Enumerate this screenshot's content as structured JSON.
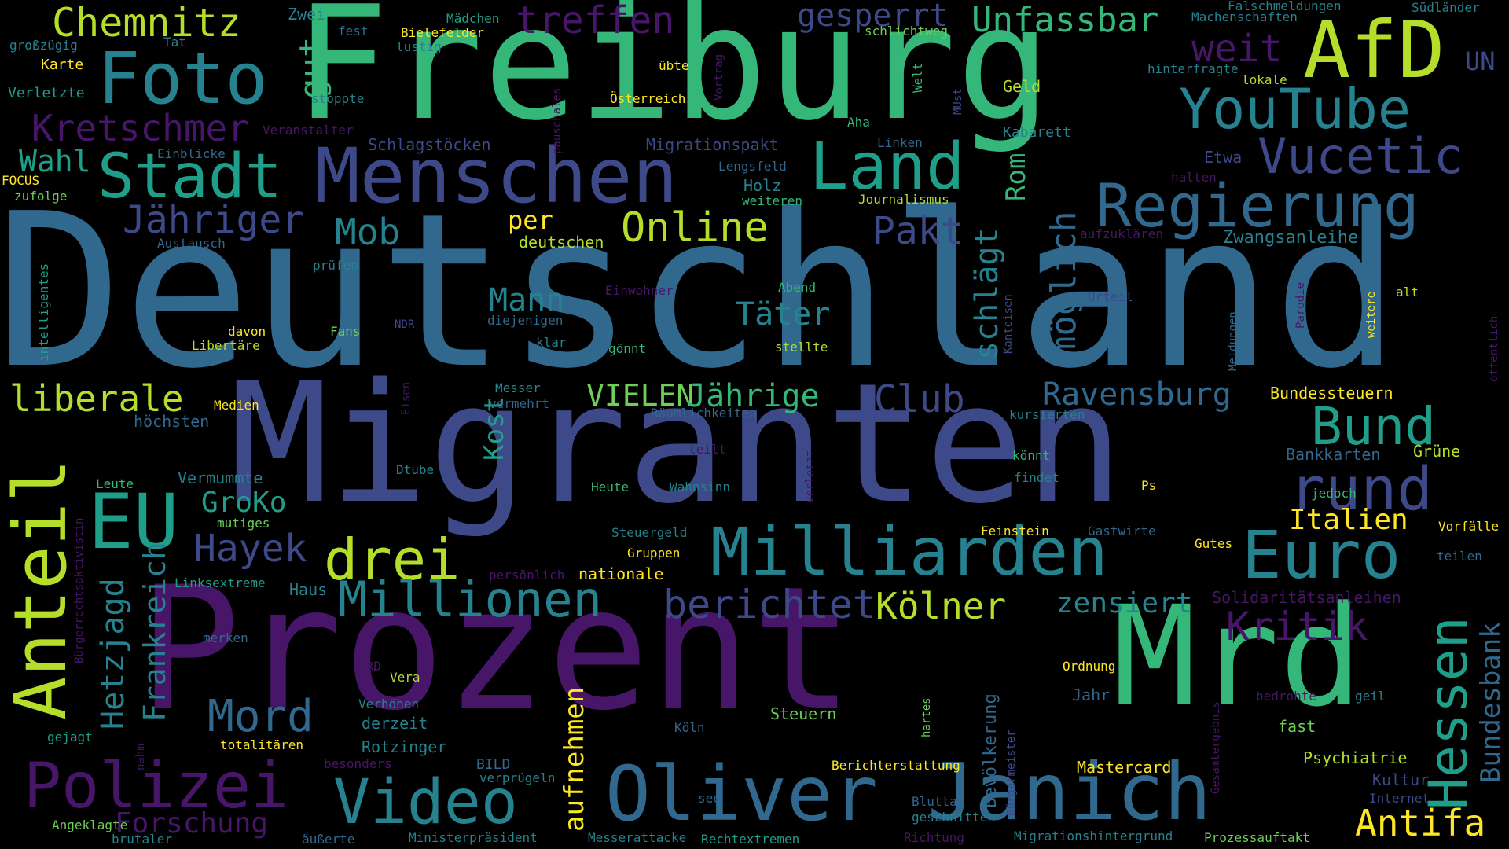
{
  "colors": {
    "background": "#000000",
    "dark_purple": "#481668",
    "indigo": "#3e4989",
    "steel_blue": "#31688e",
    "teal_blue": "#26828e",
    "teal": "#1f9e89",
    "green": "#35b779",
    "light_green": "#6ece58",
    "lime": "#b5de2b",
    "yellow": "#fde725"
  },
  "words": [
    "Freiburg",
    "Deutschland",
    "Migranten",
    "Prozent",
    "Mrd",
    "Janich",
    "Oliver",
    "AfD",
    "Foto",
    "Chemnitz",
    "Menschen",
    "Stadt",
    "Land",
    "YouTube",
    "Vucetic",
    "Regierung",
    "Milliarden",
    "Euro",
    "Anteil",
    "EU",
    "Polizei",
    "Video",
    "Hessen",
    "rund",
    "Bund",
    "drei",
    "Millionen",
    "Kretschmer",
    "treffen",
    "gesperrt",
    "Unfassbar",
    "weit",
    "gut",
    "Wahl",
    "Jähriger",
    "Mob",
    "Online",
    "Pakt",
    "Club",
    "Ravensburg",
    "möglich",
    "schlägt",
    "Rom",
    "Mann",
    "Täter",
    "liberale",
    "VIELEN",
    "Jährige",
    "Hayek",
    "GroKo",
    "Hetzjagd",
    "Frankreich",
    "Mord",
    "berichtet",
    "Kölner",
    "zensiert",
    "Kritik",
    "Italien",
    "Antifa",
    "Bundesbank",
    "aufnehmen",
    "Forschung",
    "Kost",
    "per",
    "deutschen",
    "UN",
    "Migrationspakt",
    "Schlagstöcken",
    "Zwangsanleihe",
    "Bundessteuern",
    "Bankkarten",
    "Grüne",
    "Solidaritätsanleihen",
    "Bevölkerung",
    "Mastercard",
    "Psychiatrie",
    "Kultur",
    "Steuern",
    "Ordnung",
    "Jahr",
    "fast",
    "Zwei",
    "Mädchen",
    "Bielefelder",
    "lustig",
    "fest",
    "großzügig",
    "Tat",
    "Karte",
    "Verletzte",
    "stoppte",
    "Veranstalter",
    "Einblicke",
    "FOCUS",
    "zufolge",
    "Austausch",
    "intelligentes",
    "prüfen",
    "davon",
    "Libertäre",
    "Fans",
    "NDR",
    "Medien",
    "höchsten",
    "Vermummte",
    "Leute",
    "mutiges",
    "Linksextreme",
    "Haus",
    "Bürgerrechtsaktivistin",
    "merken",
    "gejagt",
    "nahm",
    "Angeklagte",
    "brutaler",
    "äußerte",
    "Ministerpräsident",
    "Messerattacke",
    "Rechtextremen",
    "Richtung",
    "Migrationshintergrund",
    "Prozessauftakt",
    "Falschmeldungen",
    "Machenschaften",
    "Südländer",
    "schlichtweg",
    "Welt",
    "MUst",
    "Vortrag",
    "übte",
    "Österreich",
    "pauschales",
    "Aha",
    "Linken",
    "Lengsfeld",
    "Holz",
    "weiteren",
    "Journalismus",
    "Geld",
    "Kabarett",
    "Etwa",
    "halten",
    "hinterfragte",
    "lokale",
    "aufzuklären",
    "Einwohner",
    "Abend",
    "Urteil",
    "alt",
    "weitere",
    "Parodie",
    "Meldungen",
    "Kanteisen",
    "öffentlich",
    "diejenigen",
    "klar",
    "gönnt",
    "stellte",
    "Eisen",
    "Messer",
    "vermehrt",
    "Räumlichkeiten",
    "kursierten",
    "teilt",
    "Dtube",
    "Heute",
    "Wahnsinn",
    "verletzt",
    "könnt",
    "findet",
    "Ps",
    "jedoch",
    "Vorfälle",
    "teilen",
    "Steuergeld",
    "Gruppen",
    "persönlich",
    "nationale",
    "Feinstein",
    "Gastwirte",
    "Gutes",
    "ARD",
    "Vera",
    "Verhöhen",
    "derzeit",
    "Rotzinger",
    "Köln",
    "hartes",
    "Gesamtergebnis",
    "bedrohte",
    "geil",
    "besonders",
    "BILD",
    "verprügeln",
    "totalitären",
    "Berichterstattung",
    "Bürgermeister",
    "Bluttat",
    "geschnitten",
    "see",
    "Internet"
  ]
}
